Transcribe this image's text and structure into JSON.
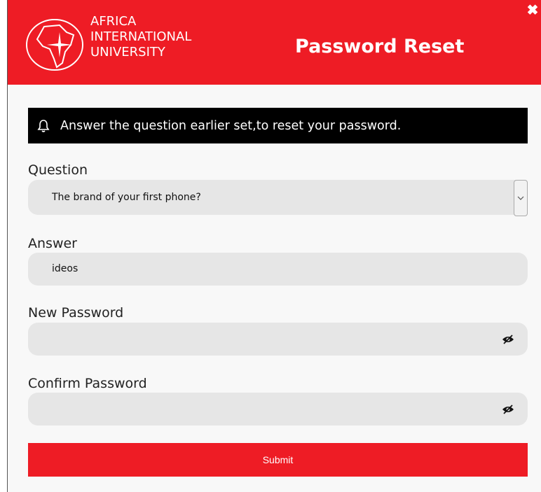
{
  "header": {
    "university_line1": "AFRICA",
    "university_line2": "INTERNATIONAL",
    "university_line3": "UNIVERSITY",
    "title": "Password Reset",
    "close_symbol": "✖"
  },
  "alert": {
    "icon": "bell-icon",
    "text": "Answer the question earlier set,to reset your password."
  },
  "form": {
    "question_label": "Question",
    "question_value": "The brand of your first phone?",
    "answer_label": "Answer",
    "answer_value": "ideos",
    "new_password_label": "New Password",
    "new_password_value": "",
    "confirm_password_label": "Confirm Password",
    "confirm_password_value": "",
    "submit_label": "Submit"
  },
  "colors": {
    "brand_red": "#ee1c25",
    "field_bg": "#e6e6e6",
    "alert_bg": "#000000"
  }
}
